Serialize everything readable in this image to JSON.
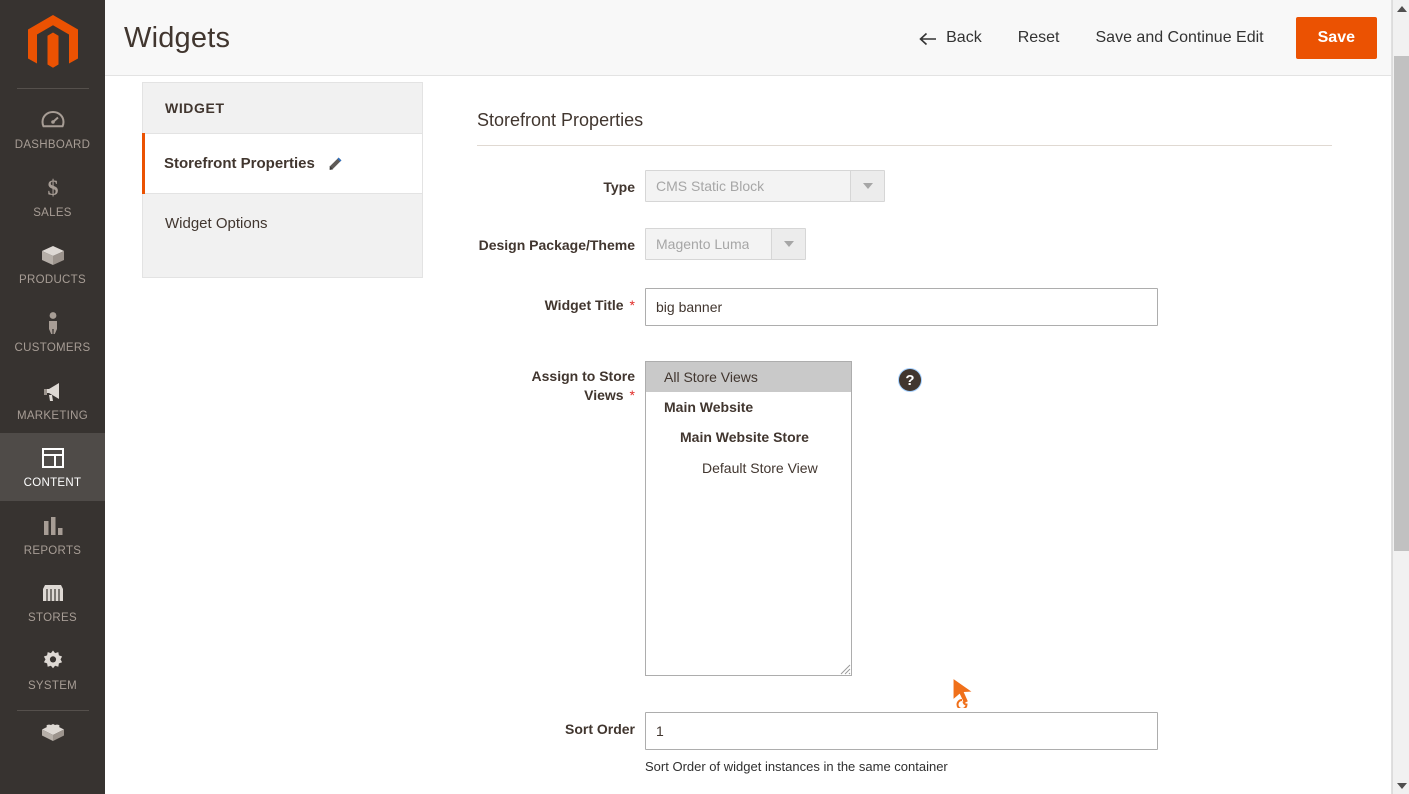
{
  "app": {
    "logo_name": "magento-logo",
    "accent_color": "#eb5202",
    "sidebar_bg": "#373330",
    "sidebar_active_bg": "#4f4b48"
  },
  "sidebar": {
    "items": [
      {
        "label": "DASHBOARD",
        "icon": "dashboard-gauge-icon",
        "active": false
      },
      {
        "label": "SALES",
        "icon": "dollar-sign-icon",
        "active": false
      },
      {
        "label": "PRODUCTS",
        "icon": "box-icon",
        "active": false
      },
      {
        "label": "CUSTOMERS",
        "icon": "person-icon",
        "active": false
      },
      {
        "label": "MARKETING",
        "icon": "megaphone-icon",
        "active": false
      },
      {
        "label": "CONTENT",
        "icon": "layout-window-icon",
        "active": true
      },
      {
        "label": "REPORTS",
        "icon": "bar-chart-icon",
        "active": false
      },
      {
        "label": "STORES",
        "icon": "storefront-icon",
        "active": false
      },
      {
        "label": "SYSTEM",
        "icon": "gear-icon",
        "active": false
      },
      {
        "label": "",
        "icon": "extensions-brick-icon",
        "active": false
      }
    ]
  },
  "header": {
    "title": "Widgets",
    "back_label": "Back",
    "reset_label": "Reset",
    "save_continue_label": "Save and Continue Edit",
    "save_label": "Save"
  },
  "widget_panel": {
    "title": "WIDGET",
    "tabs": [
      {
        "label": "Storefront Properties",
        "active": true,
        "icon": "pencil-icon"
      },
      {
        "label": "Widget Options",
        "active": false,
        "icon": ""
      }
    ]
  },
  "form": {
    "section_title": "Storefront Properties",
    "type": {
      "label": "Type",
      "value": "CMS Static Block",
      "disabled": true
    },
    "design_theme": {
      "label": "Design Package/Theme",
      "value": "Magento Luma",
      "disabled": true
    },
    "widget_title": {
      "label": "Widget Title",
      "required_marker": "*",
      "value": "big banner",
      "placeholder": ""
    },
    "store_views": {
      "label": "Assign to Store Views",
      "required_marker": "*",
      "help_icon": "?",
      "options": [
        {
          "label": "All Store Views",
          "level": 0,
          "selected": true
        },
        {
          "label": "Main Website",
          "level": 1,
          "selected": false
        },
        {
          "label": "Main Website Store",
          "level": 2,
          "selected": false
        },
        {
          "label": "Default Store View",
          "level": 3,
          "selected": false
        }
      ]
    },
    "sort_order": {
      "label": "Sort Order",
      "value": "1",
      "placeholder": "",
      "note": "Sort Order of widget instances in the same container"
    }
  },
  "scrollbar": {
    "up_arrow": "chevron-up-icon",
    "down_arrow": "chevron-down-icon"
  }
}
